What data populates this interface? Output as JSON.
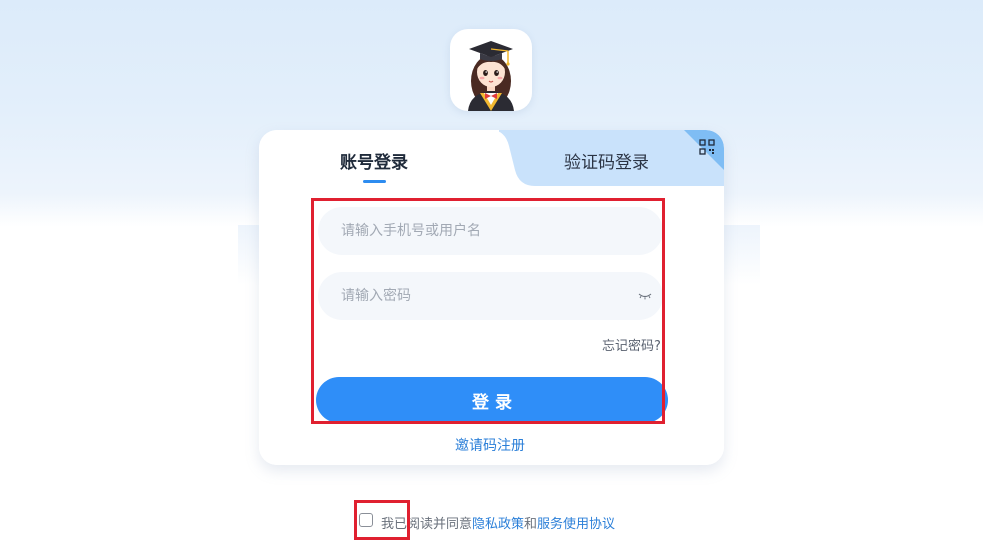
{
  "login_tabs": {
    "account_label": "账号登录",
    "code_label": "验证码登录"
  },
  "form": {
    "username_placeholder": "请输入手机号或用户名",
    "username_value": "",
    "password_placeholder": "请输入密码",
    "password_value": "",
    "forgot_label": "忘记密码?",
    "login_label": "登录",
    "invite_label": "邀请码注册"
  },
  "agreement": {
    "checked": false,
    "prefix_text": "我已阅读并同意",
    "privacy_link": "隐私政策",
    "conjunction": "和",
    "terms_link": "服务使用协议"
  },
  "icons": {
    "avatar": "graduate-girl-avatar",
    "qr": "qr-code-icon",
    "password_visibility": "eye-closed-icon"
  },
  "colors": {
    "accent": "#2f8ef8",
    "link": "#2b7fd8",
    "tab_inactive_bg": "#c9e2fb",
    "annotation": "#e02030"
  }
}
